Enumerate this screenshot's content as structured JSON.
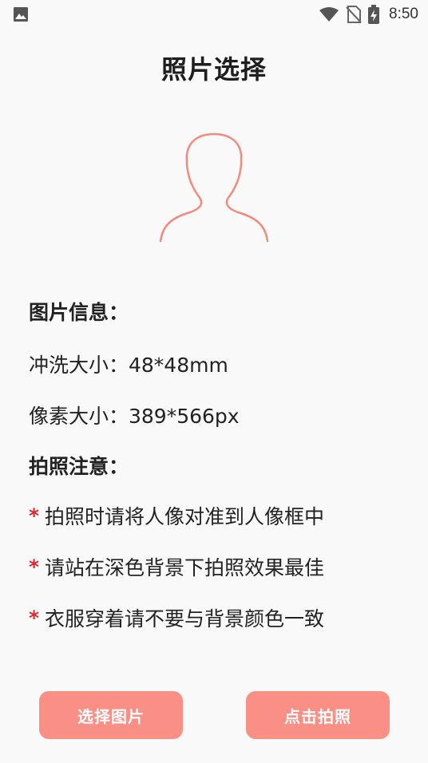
{
  "status_bar": {
    "time": "8:50",
    "icons": [
      "image-icon",
      "wifi-icon",
      "no-sim-icon",
      "battery-charging-icon"
    ]
  },
  "page": {
    "title": "照片选择"
  },
  "info": {
    "heading": "图片信息：",
    "print_size": "冲洗大小：48*48mm",
    "pixel_size": "像素大小：389*566px"
  },
  "notes": {
    "heading": "拍照注意：",
    "marker": "*",
    "items": [
      "拍照时请将人像对准到人像框中",
      "请站在深色背景下拍照效果最佳",
      "衣服穿着请不要与背景颜色一致"
    ]
  },
  "buttons": {
    "choose_image": "选择图片",
    "take_photo": "点击拍照"
  },
  "colors": {
    "accent": "#fa8f86",
    "marker": "#e0262e",
    "background": "#f9f9f9"
  }
}
